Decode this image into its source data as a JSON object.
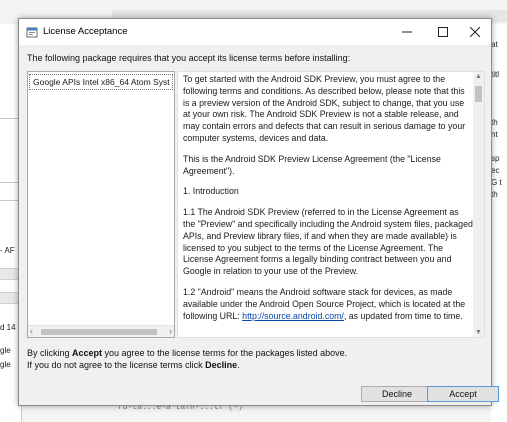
{
  "dialog": {
    "title": "License Acceptance",
    "intro": "The following package requires that you accept its license terms before installing:",
    "packages": [
      "Google APIs Intel x86_64 Atom Syst"
    ],
    "license_paragraphs": [
      "To get started with the Android SDK Preview, you must agree to the following terms and conditions. As described below, please note that this is a preview version of the Android SDK, subject to change, that you use at your own risk.  The Android SDK Preview is not a stable release, and may contain errors and defects that can result in serious damage to your computer systems, devices and data.",
      "This is the Android SDK Preview License Agreement (the \"License Agreement\").",
      "1. Introduction",
      "1.1 The Android SDK Preview (referred to in the License Agreement as the \"Preview\" and specifically including the Android system files, packaged APIs, and Preview library files, if and when they are made available) is licensed to you subject to the terms of the License Agreement. The License Agreement forms a legally binding contract between you and Google in relation to your use of the Preview."
    ],
    "license_p5_before": "1.2 \"Android\" means the Android software stack for devices, as made available under the Android Open Source Project, which is located at the following URL: ",
    "license_p5_link": "http://source.android.com/",
    "license_p5_after": ", as updated from time to time.",
    "notice_line1_pre": "By clicking ",
    "notice_line1_bold": "Accept",
    "notice_line1_post": " you agree to the license terms for the packages listed above.",
    "notice_line2_pre": "If you do not agree to the license terms click ",
    "notice_line2_bold": "Decline",
    "notice_line2_post": ".",
    "decline_label": "Decline",
    "accept_label": "Accept",
    "window_controls": [
      "minimize-icon",
      "maximize-icon",
      "close-icon"
    ]
  },
  "background": {
    "left_labels": [
      "- AF",
      "d 14",
      "gle",
      "gle"
    ],
    "right_labels": [
      "at",
      "titl",
      "th",
      "nt",
      "sp",
      "ec",
      "G t",
      "th"
    ],
    "bottom_snippet": "rb-ta...e-a tafh-...tf     (-)"
  }
}
